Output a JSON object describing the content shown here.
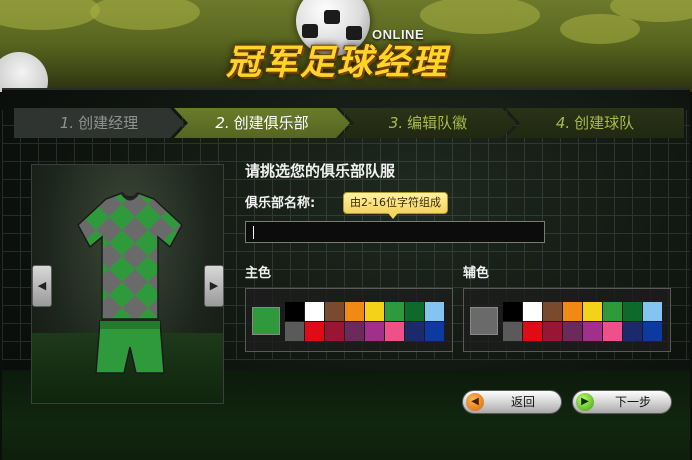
{
  "header": {
    "logo_text": "冠军足球经理",
    "online_text": "ONLINE"
  },
  "steps": [
    {
      "num": "1.",
      "label": "创建经理",
      "state": "done"
    },
    {
      "num": "2.",
      "label": "创建俱乐部",
      "state": "active"
    },
    {
      "num": "3.",
      "label": "编辑队徽",
      "state": "pending"
    },
    {
      "num": "4.",
      "label": "创建球队",
      "state": "pending"
    }
  ],
  "preview": {
    "prev_icon": "triangle-left-icon",
    "next_icon": "triangle-right-icon",
    "jersey_colors": {
      "primary": "#2f9a3c",
      "secondary": "#6a6a6a"
    }
  },
  "form": {
    "title": "请挑选您的俱乐部队服",
    "name_label": "俱乐部名称:",
    "name_tooltip": "由2-16位字符组成",
    "name_value": "",
    "primary_label": "主色",
    "secondary_label": "辅色",
    "primary_selected": "#2f9a3c",
    "secondary_selected": "#6a6a6a",
    "palette": [
      [
        "#000000",
        "#ffffff",
        "#7a4a2e",
        "#f08a14",
        "#f4d21a",
        "#2f9a3c",
        "#0d6a2a",
        "#84c4f0"
      ],
      [
        "#5a5a5a",
        "#e00b14",
        "#9a1433",
        "#6a2a5a",
        "#a2308a",
        "#f0508a",
        "#1a2a6a",
        "#0d3aa0"
      ]
    ]
  },
  "buttons": {
    "back_label": "返回",
    "back_icon": "left-arrow-icon",
    "next_label": "下一步",
    "next_icon": "right-arrow-icon"
  }
}
